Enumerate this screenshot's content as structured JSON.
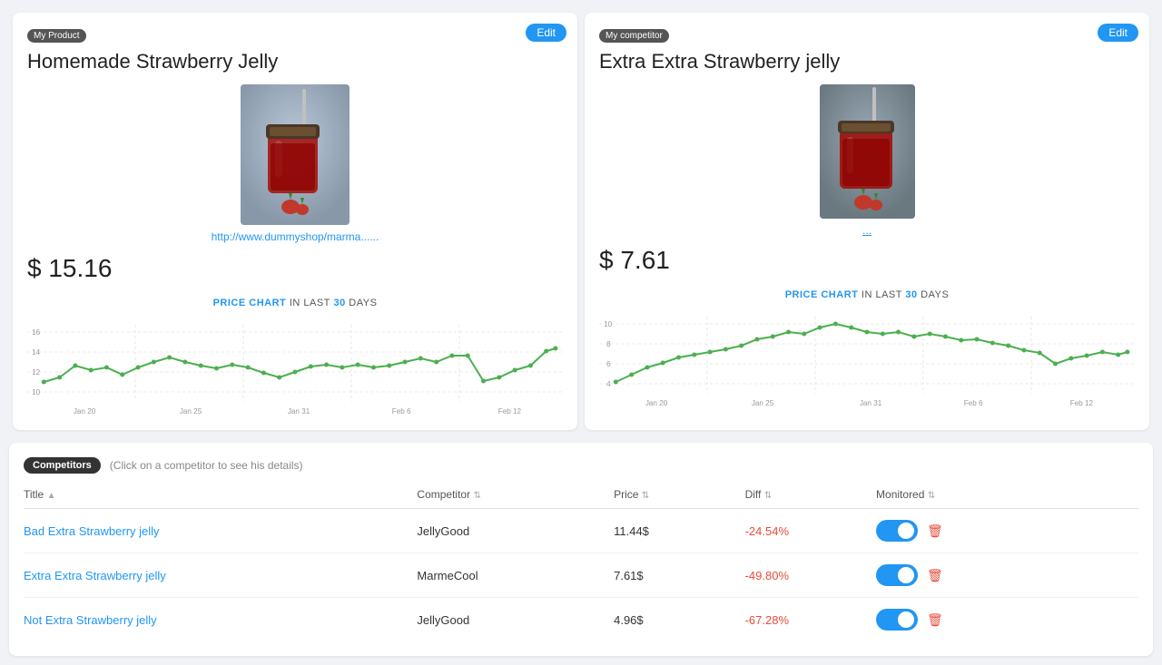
{
  "myProduct": {
    "badge": "My Product",
    "title": "Homemade Strawberry Jelly",
    "editLabel": "Edit",
    "imageAlt": "Homemade Strawberry Jelly product image",
    "link": "http://www.dummyshop/marma......",
    "price": "$ 15.16",
    "chartTitle": "PRICE CHART",
    "chartIn": "IN LAST",
    "chartDays": "30",
    "chartDaysSuffix": " DAYS",
    "chartYMin": 10,
    "chartYMax": 16,
    "chartLabels": [
      "Jan 20",
      "Jan 25",
      "Jan 31",
      "Feb 6",
      "Feb 12"
    ],
    "chartData": [
      11.5,
      12.0,
      13.5,
      13.0,
      12.5,
      11.8,
      12.8,
      13.5,
      14.0,
      13.2,
      12.8,
      12.4,
      13.0,
      12.6,
      12.0,
      11.5,
      12.2,
      13.0,
      13.2,
      12.8,
      13.0,
      12.5,
      12.8,
      13.2,
      13.5,
      13.0,
      13.8,
      14.0,
      11.2,
      11.8,
      12.5,
      13.2,
      14.5,
      15.0
    ]
  },
  "competitor": {
    "badge": "My competitor",
    "title": "Extra Extra Strawberry jelly",
    "editLabel": "Edit",
    "imageAlt": "Extra Extra Strawberry Jelly product image",
    "link": "...",
    "price": "$ 7.61",
    "chartTitle": "PRICE CHART",
    "chartIn": "IN LAST",
    "chartDays": "30",
    "chartDaysSuffix": " DAYS",
    "chartYMin": 4,
    "chartYMax": 10,
    "chartLabels": [
      "Jan 20",
      "Jan 25",
      "Jan 31",
      "Feb 6",
      "Feb 12"
    ],
    "chartData": [
      4.2,
      5.0,
      5.8,
      6.2,
      6.8,
      7.0,
      7.2,
      7.5,
      8.0,
      8.5,
      8.8,
      9.0,
      8.8,
      9.2,
      9.5,
      9.0,
      8.5,
      8.8,
      8.5,
      8.2,
      8.5,
      8.0,
      7.8,
      8.0,
      7.5,
      7.2,
      7.5,
      7.2,
      6.5,
      7.0,
      7.2,
      7.5,
      7.2,
      7.8
    ]
  },
  "competitors": {
    "badge": "Competitors",
    "hint": "(Click on a competitor to see his details)",
    "columns": {
      "title": "Title",
      "competitor": "Competitor",
      "price": "Price",
      "diff": "Diff",
      "monitored": "Monitored"
    },
    "rows": [
      {
        "title": "Bad Extra Strawberry jelly",
        "competitor": "JellyGood",
        "price": "11.44$",
        "diff": "-24.54%",
        "monitored": true
      },
      {
        "title": "Extra Extra Strawberry jelly",
        "competitor": "MarmeCool",
        "price": "7.61$",
        "diff": "-49.80%",
        "monitored": true
      },
      {
        "title": "Not Extra Strawberry jelly",
        "competitor": "JellyGood",
        "price": "4.96$",
        "diff": "-67.28%",
        "monitored": true
      }
    ]
  }
}
